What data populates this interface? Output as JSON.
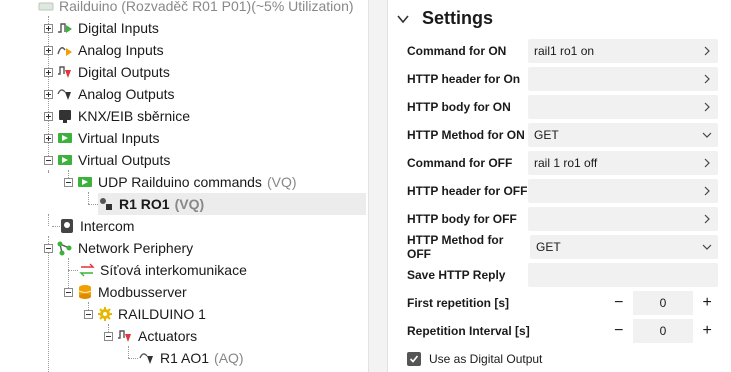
{
  "tree": {
    "root": {
      "label": "Railduino (Rozvaděč R01 P01)(~5% Utilization)"
    },
    "items": [
      {
        "label": "Digital Inputs"
      },
      {
        "label": "Analog Inputs"
      },
      {
        "label": "Digital Outputs"
      },
      {
        "label": "Analog Outputs"
      },
      {
        "label": "KNX/EIB sběrnice"
      },
      {
        "label": "Virtual Inputs"
      },
      {
        "label": "Virtual Outputs"
      },
      {
        "label": "UDP Railduino commands",
        "sub": "(VQ)"
      },
      {
        "label": "R1 RO1",
        "sub": "(VQ)"
      },
      {
        "label": "Intercom"
      },
      {
        "label": "Network Periphery"
      },
      {
        "label": "Síťová interkomunikace"
      },
      {
        "label": "Modbusserver"
      },
      {
        "label": "RAILDUINO 1"
      },
      {
        "label": "Actuators"
      },
      {
        "label": "R1 AO1",
        "sub": "(AQ)"
      }
    ]
  },
  "settings": {
    "title": "Settings",
    "rows": [
      {
        "label": "Command for ON",
        "value": "rail1 ro1 on"
      },
      {
        "label": "HTTP header for On",
        "value": ""
      },
      {
        "label": "HTTP body for ON",
        "value": ""
      },
      {
        "label": "HTTP Method for ON",
        "value": "GET"
      },
      {
        "label": "Command for OFF",
        "value": "rail 1 ro1 off"
      },
      {
        "label": "HTTP header for OFF",
        "value": ""
      },
      {
        "label": "HTTP body for OFF",
        "value": ""
      },
      {
        "label": "HTTP Method for OFF",
        "value": "GET"
      },
      {
        "label": "Save HTTP Reply",
        "value": ""
      },
      {
        "label": "First repetition [s]",
        "value": "0"
      },
      {
        "label": "Repetition Interval [s]",
        "value": "0"
      }
    ],
    "checkbox": {
      "label": "Use as Digital Output",
      "checked": true
    },
    "minus": "−",
    "plus": "+"
  },
  "colors": {
    "selection": "#ececec",
    "field": "#f1f1f1",
    "accent_green": "#3cb13c",
    "accent_red": "#e0353a",
    "modbus_orange": "#f0a000"
  }
}
